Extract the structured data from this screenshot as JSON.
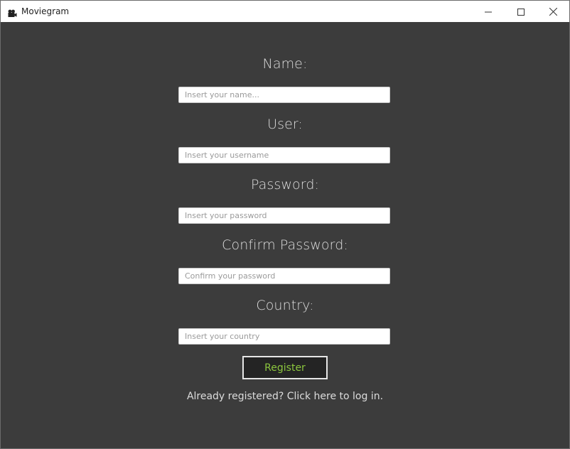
{
  "window": {
    "title": "Moviegram",
    "icon": "movie-camera-icon",
    "controls": [
      "minimize-icon",
      "maximize-icon",
      "close-icon"
    ]
  },
  "form": {
    "name": {
      "label": "Name:",
      "placeholder": "Insert your name...",
      "value": ""
    },
    "user": {
      "label": "User:",
      "placeholder": "Insert your username",
      "value": ""
    },
    "password": {
      "label": "Password:",
      "placeholder": "Insert your password",
      "value": ""
    },
    "confirm_password": {
      "label": "Confirm Password:",
      "placeholder": "Confirm your password",
      "value": ""
    },
    "country": {
      "label": "Country:",
      "placeholder": "Insert your country",
      "value": ""
    }
  },
  "register_button": {
    "label": "Register"
  },
  "login_link": {
    "text": "Already registered? Click here to log in."
  },
  "colors": {
    "background": "#3c3c3c",
    "accent": "#8cc63e",
    "button_bg": "#242424",
    "label_text": "#dcdcdc"
  }
}
